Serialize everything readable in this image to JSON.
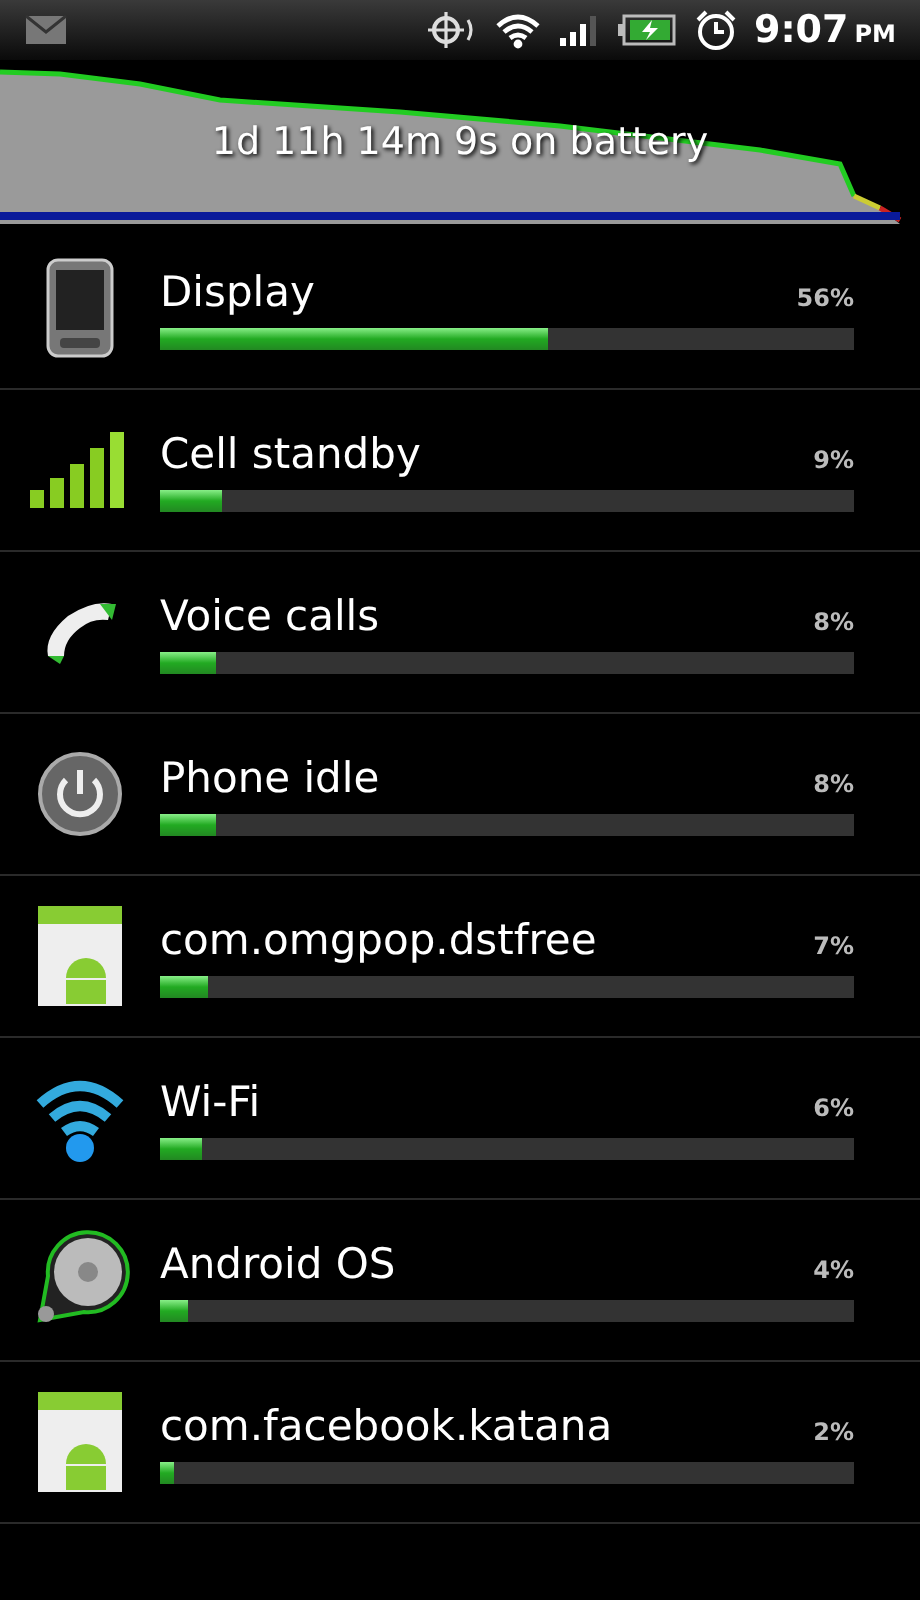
{
  "status_bar": {
    "time": "9:07",
    "ampm": "PM"
  },
  "battery_graph": {
    "summary": "1d 11h 14m 9s on battery"
  },
  "items": [
    {
      "kind": "display",
      "name": "Display",
      "percent": "56%",
      "level": 0.56
    },
    {
      "kind": "cell",
      "name": "Cell standby",
      "percent": "9%",
      "level": 0.09
    },
    {
      "kind": "voice",
      "name": "Voice calls",
      "percent": "8%",
      "level": 0.08
    },
    {
      "kind": "idle",
      "name": "Phone idle",
      "percent": "8%",
      "level": 0.08
    },
    {
      "kind": "app",
      "name": "com.omgpop.dstfree",
      "percent": "7%",
      "level": 0.07
    },
    {
      "kind": "wifi",
      "name": "Wi-Fi",
      "percent": "6%",
      "level": 0.06
    },
    {
      "kind": "system",
      "name": "Android OS",
      "percent": "4%",
      "level": 0.04
    },
    {
      "kind": "app",
      "name": "com.facebook.katana",
      "percent": "2%",
      "level": 0.02
    }
  ]
}
